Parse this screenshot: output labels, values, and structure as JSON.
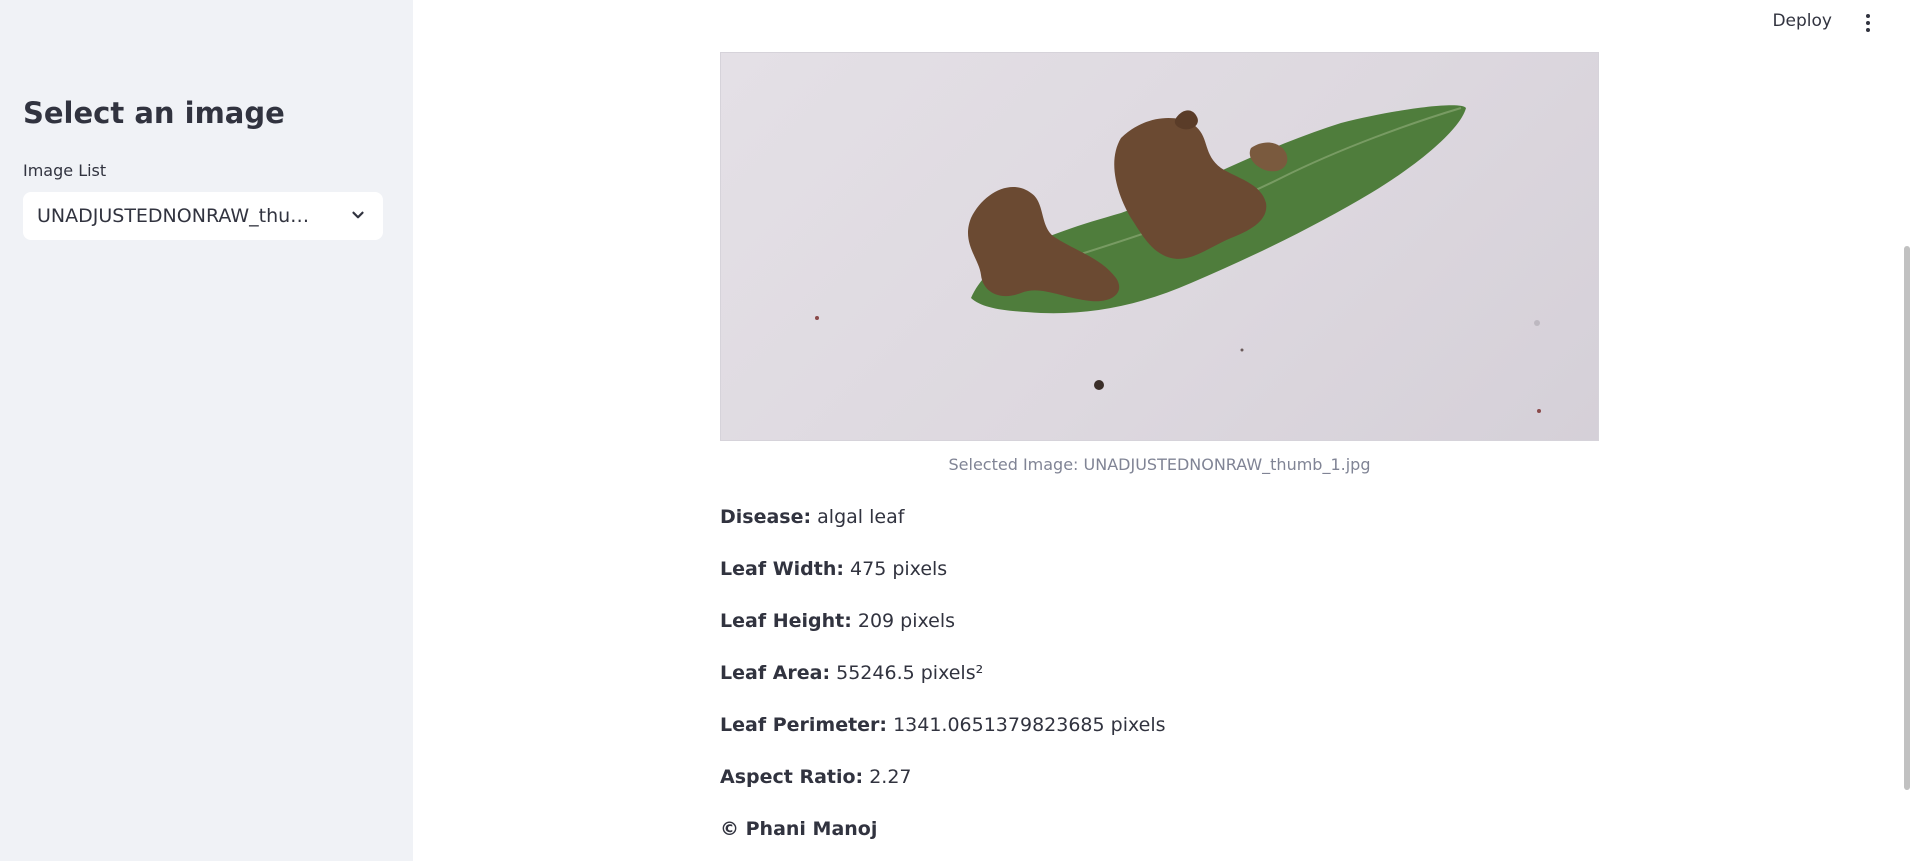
{
  "sidebar": {
    "title": "Select an image",
    "select_label": "Image List",
    "select_value": "UNADJUSTEDNONRAW_thumb_1.jpg"
  },
  "toolbar": {
    "deploy_label": "Deploy"
  },
  "main": {
    "caption": "Selected Image: UNADJUSTEDNONRAW_thumb_1.jpg",
    "fields": [
      {
        "label": "Disease:",
        "value": "algal leaf"
      },
      {
        "label": "Leaf Width:",
        "value": "475 pixels"
      },
      {
        "label": "Leaf Height:",
        "value": "209 pixels"
      },
      {
        "label": "Leaf Area:",
        "value": "55246.5 pixels²"
      },
      {
        "label": "Leaf Perimeter:",
        "value": "1341.0651379823685 pixels"
      },
      {
        "label": "Aspect Ratio:",
        "value": "2.27"
      }
    ],
    "footer": "© Phani Manoj"
  },
  "colors": {
    "sidebar_bg": "#f0f2f6",
    "text": "#31333f",
    "caption": "#808495",
    "leaf_green": "#4f7d3c",
    "leaf_brown": "#6b4a32"
  },
  "icons": {
    "select_chevron": "chevron-down-icon",
    "menu": "more-vert-icon"
  }
}
